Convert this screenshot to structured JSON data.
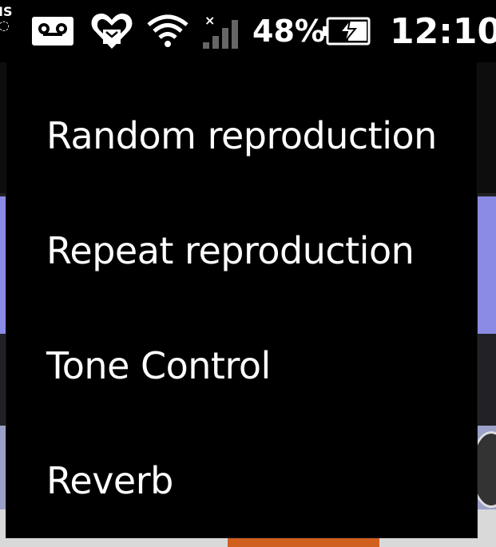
{
  "status_bar": {
    "edge_text_top": "IS",
    "battery_percent_text": "48%",
    "time": "12:10",
    "icons": [
      "voicemail-icon",
      "heart-notification-icon",
      "wifi-icon",
      "signal-no-service-icon",
      "battery-charging-icon"
    ]
  },
  "menu": {
    "items": [
      {
        "label": "Random reproduction"
      },
      {
        "label": "Repeat reproduction"
      },
      {
        "label": "Tone Control"
      },
      {
        "label": "Reverb"
      }
    ]
  },
  "colors": {
    "menu_background": "#000000",
    "menu_text": "#ffffff",
    "background_header": "#8b8be6"
  }
}
